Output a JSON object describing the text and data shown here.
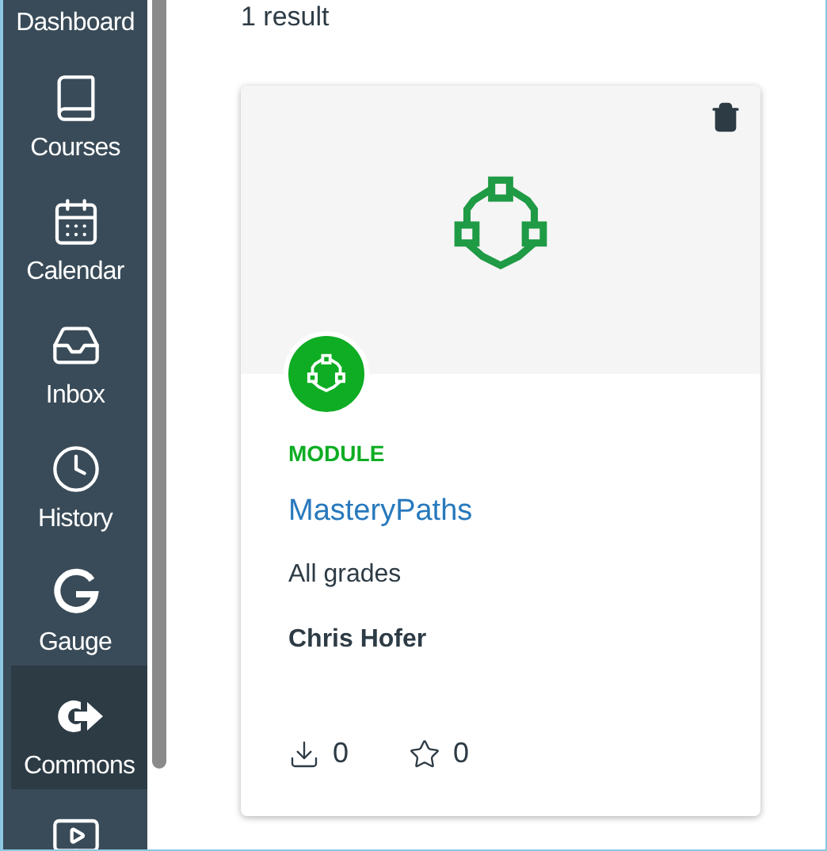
{
  "sidebar": {
    "items": [
      {
        "kind": "dashboard",
        "label": "Dashboard",
        "selected": false
      },
      {
        "kind": "courses",
        "label": "Courses",
        "selected": false
      },
      {
        "kind": "calendar",
        "label": "Calendar",
        "selected": false
      },
      {
        "kind": "inbox",
        "label": "Inbox",
        "selected": false
      },
      {
        "kind": "history",
        "label": "History",
        "selected": false
      },
      {
        "kind": "gauge",
        "label": "Gauge",
        "selected": false
      },
      {
        "kind": "commons",
        "label": "Commons",
        "selected": true
      },
      {
        "kind": "video",
        "selected": false
      }
    ]
  },
  "results": {
    "count": "1 result"
  },
  "card": {
    "type": "MODULE",
    "title": "MasteryPaths",
    "grades": "All grades",
    "author": "Chris Hofer",
    "downloads": "0",
    "favorites": "0"
  }
}
